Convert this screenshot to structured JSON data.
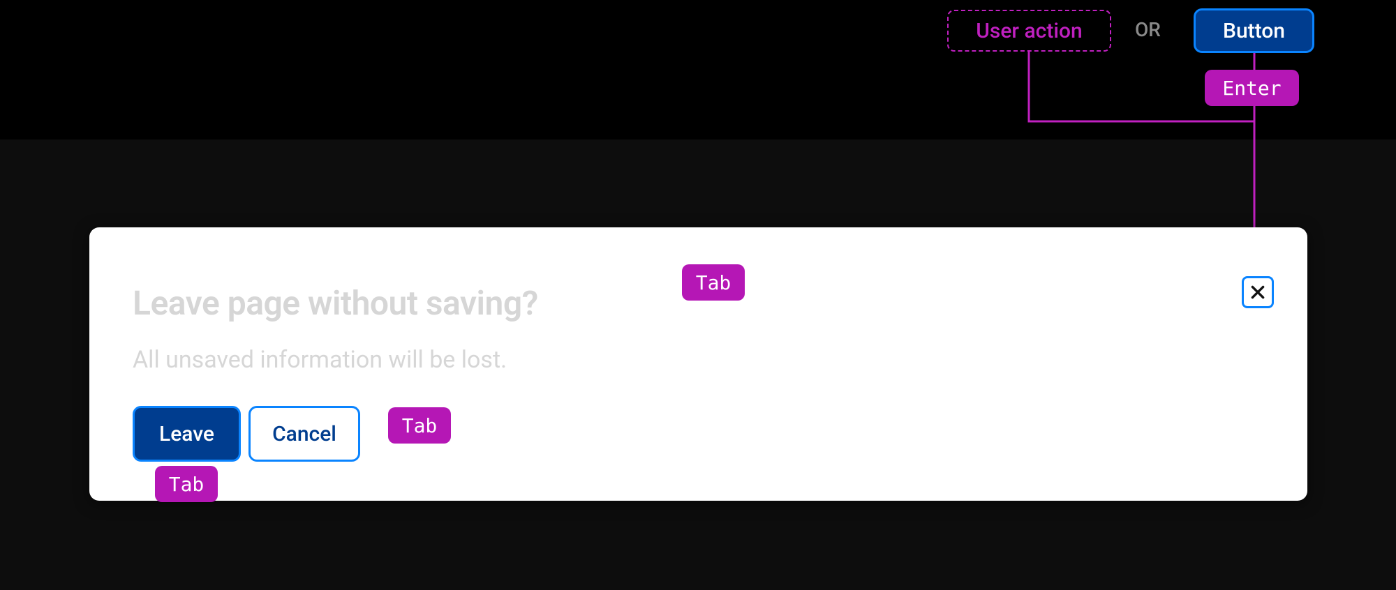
{
  "legend": {
    "user_action": "User action",
    "or": "OR",
    "button": "Button"
  },
  "keys": {
    "enter": "Enter",
    "tab1": "Tab",
    "tab2": "Tab",
    "tab3": "Tab"
  },
  "modal": {
    "title": "Leave page without saving?",
    "subtitle": "All unsaved information will be lost.",
    "leave_btn": "Leave",
    "cancel_btn": "Cancel"
  }
}
